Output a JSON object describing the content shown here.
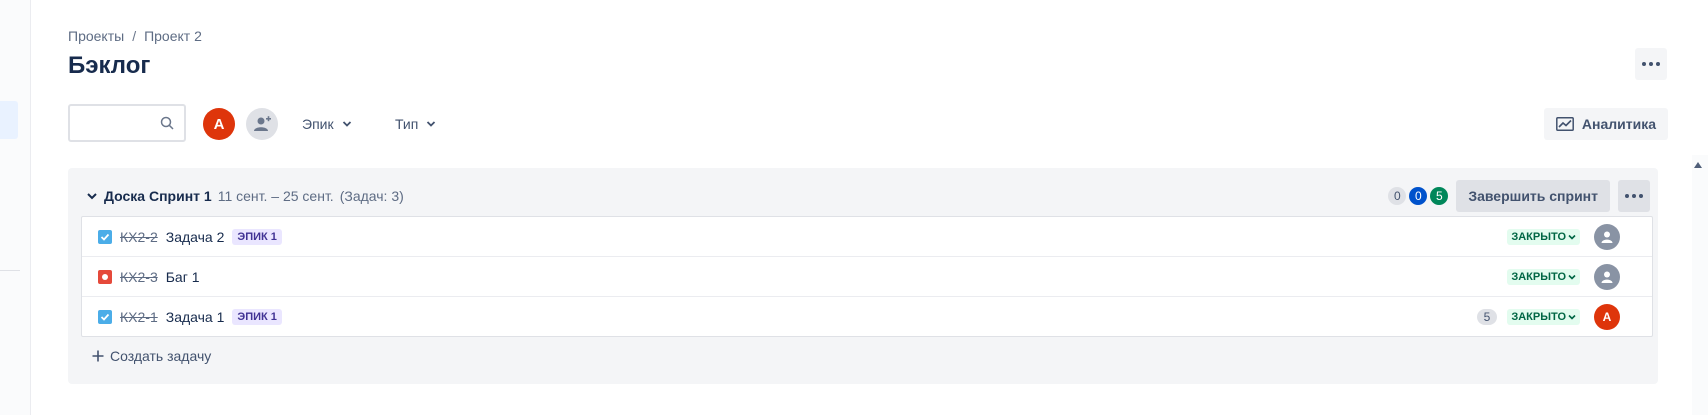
{
  "breadcrumb": {
    "items": [
      "Проекты",
      "Проект 2"
    ],
    "separator": "/"
  },
  "page": {
    "title": "Бэклог"
  },
  "search": {
    "value": "",
    "placeholder": ""
  },
  "filters": {
    "avatar_initial": "A",
    "epic_label": "Эпик",
    "type_label": "Тип"
  },
  "toolbar": {
    "analytics_label": "Аналитика"
  },
  "sprint": {
    "name": "Доска Спринт 1",
    "dates": "11 сент. – 25 сент.",
    "issue_count": "(Задач: 3)",
    "status_counts": {
      "todo": "0",
      "in_progress": "0",
      "done": "5"
    },
    "complete_label": "Завершить спринт"
  },
  "issues": [
    {
      "type": "task",
      "key": "КХ2-2",
      "summary": "Задача 2",
      "epic": "ЭПИК 1",
      "estimate": "",
      "status": "ЗАКРЫТО",
      "assignee": ""
    },
    {
      "type": "bug",
      "key": "КХ2-3",
      "summary": "Баг 1",
      "epic": "",
      "estimate": "",
      "status": "ЗАКРЫТО",
      "assignee": ""
    },
    {
      "type": "task",
      "key": "КХ2-1",
      "summary": "Задача 1",
      "epic": "ЭПИК 1",
      "estimate": "5",
      "status": "ЗАКРЫТО",
      "assignee": "A"
    }
  ],
  "create_issue_label": "Создать задачу",
  "colors": {
    "status_done_bg": "#e3fcef",
    "status_done_text": "#006644",
    "epic_bg": "#eae6ff",
    "epic_text": "#403294",
    "avatar": "#de350b",
    "task_icon": "#4bade8",
    "bug_icon": "#e5493a"
  },
  "icons": {
    "search": "search-icon",
    "add_people": "add-people-icon",
    "analytics": "analytics-icon",
    "more": "more-icon",
    "chevron": "chevron-down-icon",
    "task": "task-checkbox-icon",
    "bug": "bug-icon",
    "plus": "plus-icon"
  }
}
